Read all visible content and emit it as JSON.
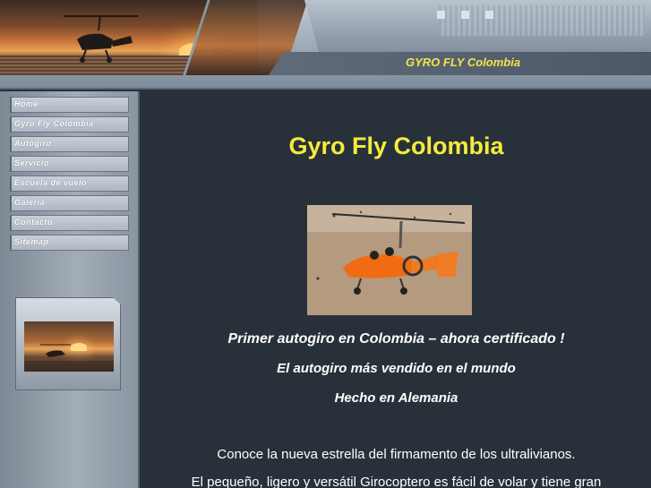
{
  "header": {
    "site_title": "GYRO FLY Colombia"
  },
  "nav": {
    "items": [
      {
        "label": "Home"
      },
      {
        "label": "Gyro Fly Colombia"
      },
      {
        "label": "Autogiro"
      },
      {
        "label": "Servicio"
      },
      {
        "label": "Escuela de vuelo"
      },
      {
        "label": "Galeria"
      },
      {
        "label": "Contacto"
      },
      {
        "label": "Sitemap"
      }
    ]
  },
  "main": {
    "title": "Gyro Fly Colombia",
    "headline": "Primer autogiro en Colombia – ahora certificado !",
    "subheading_1": "El autogiro más vendido en el mundo",
    "subheading_2": "Hecho en Alemania",
    "paragraph_1": "Conoce la nueva estrella del firmamento de los ultralivianos.",
    "paragraph_2": "El pequeño, ligero y versátil Girocoptero es fácil de volar y tiene gran"
  },
  "colors": {
    "title_yellow": "#f3ec3d",
    "main_background": "#283039",
    "sidebar_gray": "#a3adb8"
  }
}
